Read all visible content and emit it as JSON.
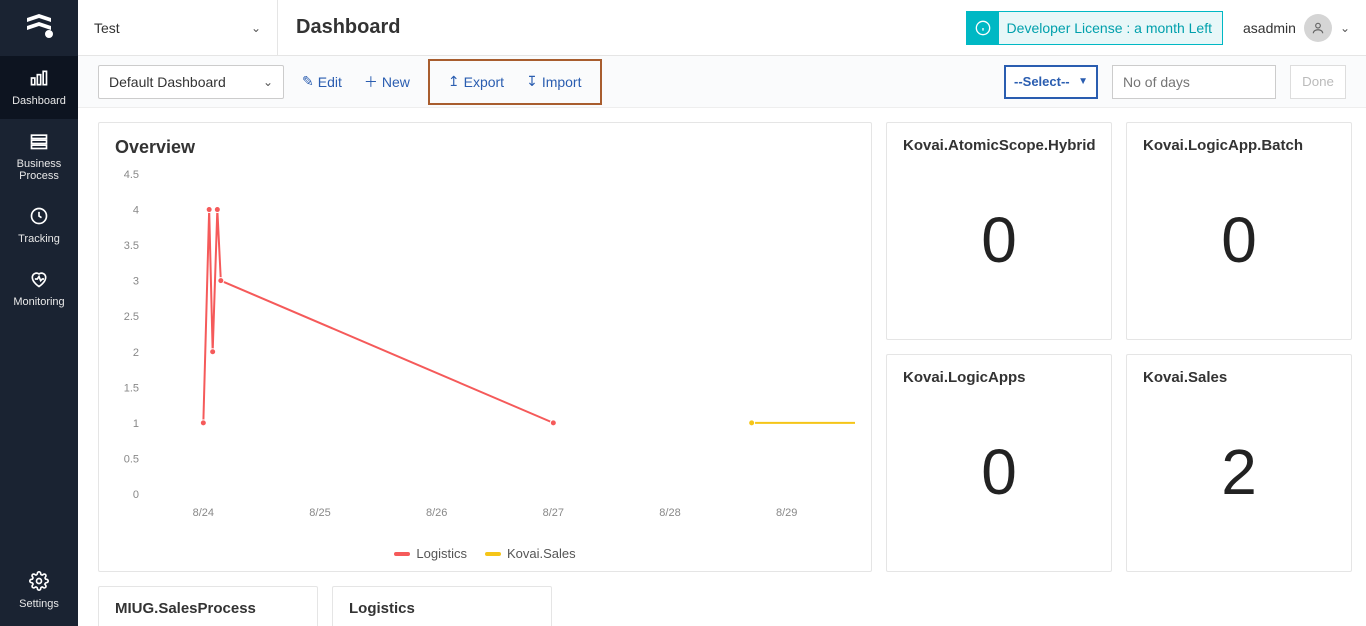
{
  "sidebar": {
    "items": [
      {
        "label": "Dashboard",
        "icon": "chart-bar"
      },
      {
        "label": "Business Process",
        "icon": "layers"
      },
      {
        "label": "Tracking",
        "icon": "clock"
      },
      {
        "label": "Monitoring",
        "icon": "heart"
      }
    ],
    "footer": {
      "label": "Settings",
      "icon": "gear"
    }
  },
  "topbar": {
    "workspace": "Test",
    "title": "Dashboard",
    "license": "Developer License : a month Left",
    "user": "asadmin"
  },
  "toolbar": {
    "dashboard_select": "Default Dashboard",
    "edit_label": "Edit",
    "new_label": "New",
    "export_label": "Export",
    "import_label": "Import",
    "select_label": "--Select--",
    "days_placeholder": "No of days",
    "done_label": "Done"
  },
  "overview": {
    "title": "Overview"
  },
  "stats": [
    {
      "title": "Kovai.AtomicScope.Hybrid",
      "value": "0"
    },
    {
      "title": "Kovai.LogicApp.Batch",
      "value": "0"
    },
    {
      "title": "Kovai.LogicApps",
      "value": "0"
    },
    {
      "title": "Kovai.Sales",
      "value": "2"
    }
  ],
  "bottom_cards": [
    {
      "title": "MIUG.SalesProcess"
    },
    {
      "title": "Logistics"
    }
  ],
  "chart_data": {
    "type": "line",
    "title": "Overview",
    "xlabel": "",
    "ylabel": "",
    "ylim": [
      0,
      4.5
    ],
    "y_ticks": [
      0,
      0.5,
      1,
      1.5,
      2,
      2.5,
      3,
      3.5,
      4,
      4.5
    ],
    "x_ticks": [
      "8/24",
      "8/25",
      "8/26",
      "8/27",
      "8/28",
      "8/29"
    ],
    "series": [
      {
        "name": "Logistics",
        "color": "#f55a5a",
        "points": [
          {
            "x": 0.0,
            "y": 1
          },
          {
            "x": 0.05,
            "y": 4
          },
          {
            "x": 0.08,
            "y": 2
          },
          {
            "x": 0.12,
            "y": 4
          },
          {
            "x": 0.15,
            "y": 3
          },
          {
            "x": 3.0,
            "y": 1
          }
        ]
      },
      {
        "name": "Kovai.Sales",
        "color": "#f5c518",
        "points": [
          {
            "x": 4.7,
            "y": 1
          },
          {
            "x": 5.9,
            "y": 1
          }
        ]
      }
    ],
    "legend": [
      "Logistics",
      "Kovai.Sales"
    ]
  }
}
